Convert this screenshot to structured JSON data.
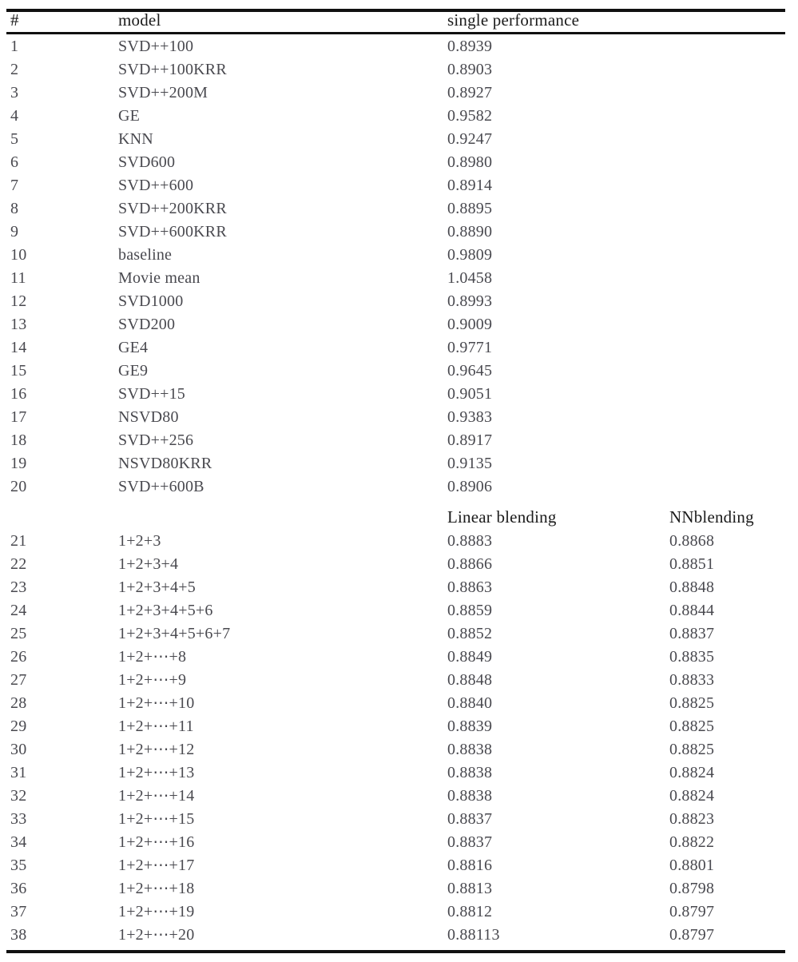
{
  "table": {
    "headers": {
      "index": "#",
      "model": "model",
      "single_performance": "single performance"
    },
    "blending_headers": {
      "linear": "Linear blending",
      "nn": "NNblending"
    },
    "single_rows": [
      {
        "num": "1",
        "model": "SVD++100",
        "value": "0.8939"
      },
      {
        "num": "2",
        "model": "SVD++100KRR",
        "value": "0.8903"
      },
      {
        "num": "3",
        "model": "SVD++200M",
        "value": "0.8927"
      },
      {
        "num": "4",
        "model": "GE",
        "value": "0.9582"
      },
      {
        "num": "5",
        "model": "KNN",
        "value": "0.9247"
      },
      {
        "num": "6",
        "model": "SVD600",
        "value": "0.8980"
      },
      {
        "num": "7",
        "model": "SVD++600",
        "value": "0.8914"
      },
      {
        "num": "8",
        "model": "SVD++200KRR",
        "value": "0.8895"
      },
      {
        "num": "9",
        "model": "SVD++600KRR",
        "value": "0.8890"
      },
      {
        "num": "10",
        "model": "baseline",
        "value": "0.9809"
      },
      {
        "num": "11",
        "model": "Movie mean",
        "value": "1.0458"
      },
      {
        "num": "12",
        "model": "SVD1000",
        "value": "0.8993"
      },
      {
        "num": "13",
        "model": "SVD200",
        "value": "0.9009"
      },
      {
        "num": "14",
        "model": "GE4",
        "value": "0.9771"
      },
      {
        "num": "15",
        "model": "GE9",
        "value": "0.9645"
      },
      {
        "num": "16",
        "model": "SVD++15",
        "value": "0.9051"
      },
      {
        "num": "17",
        "model": "NSVD80",
        "value": "0.9383"
      },
      {
        "num": "18",
        "model": "SVD++256",
        "value": "0.8917"
      },
      {
        "num": "19",
        "model": "NSVD80KRR",
        "value": "0.9135"
      },
      {
        "num": "20",
        "model": "SVD++600B",
        "value": "0.8906"
      }
    ],
    "blend_rows": [
      {
        "num": "21",
        "model": "1+2+3",
        "linear": "0.8883",
        "nn": "0.8868"
      },
      {
        "num": "22",
        "model": "1+2+3+4",
        "linear": "0.8866",
        "nn": "0.8851"
      },
      {
        "num": "23",
        "model": "1+2+3+4+5",
        "linear": "0.8863",
        "nn": "0.8848"
      },
      {
        "num": "24",
        "model": "1+2+3+4+5+6",
        "linear": "0.8859",
        "nn": "0.8844"
      },
      {
        "num": "25",
        "model": "1+2+3+4+5+6+7",
        "linear": "0.8852",
        "nn": "0.8837"
      },
      {
        "num": "26",
        "model": "1+2+⋯+8",
        "linear": "0.8849",
        "nn": "0.8835"
      },
      {
        "num": "27",
        "model": "1+2+⋯+9",
        "linear": "0.8848",
        "nn": "0.8833"
      },
      {
        "num": "28",
        "model": "1+2+⋯+10",
        "linear": "0.8840",
        "nn": "0.8825"
      },
      {
        "num": "29",
        "model": "1+2+⋯+11",
        "linear": "0.8839",
        "nn": "0.8825"
      },
      {
        "num": "30",
        "model": "1+2+⋯+12",
        "linear": "0.8838",
        "nn": "0.8825"
      },
      {
        "num": "31",
        "model": "1+2+⋯+13",
        "linear": "0.8838",
        "nn": "0.8824"
      },
      {
        "num": "32",
        "model": "1+2+⋯+14",
        "linear": "0.8838",
        "nn": "0.8824"
      },
      {
        "num": "33",
        "model": "1+2+⋯+15",
        "linear": "0.8837",
        "nn": "0.8823"
      },
      {
        "num": "34",
        "model": "1+2+⋯+16",
        "linear": "0.8837",
        "nn": "0.8822"
      },
      {
        "num": "35",
        "model": "1+2+⋯+17",
        "linear": "0.8816",
        "nn": "0.8801"
      },
      {
        "num": "36",
        "model": "1+2+⋯+18",
        "linear": "0.8813",
        "nn": "0.8798"
      },
      {
        "num": "37",
        "model": "1+2+⋯+19",
        "linear": "0.8812",
        "nn": "0.8797"
      },
      {
        "num": "38",
        "model": "1+2+⋯+20",
        "linear": "0.88113",
        "nn": "0.8797"
      }
    ]
  },
  "colors": {
    "rule": "#111111",
    "header_text": "#1b1b1b",
    "body_text": "#49494f",
    "background": "#ffffff"
  }
}
